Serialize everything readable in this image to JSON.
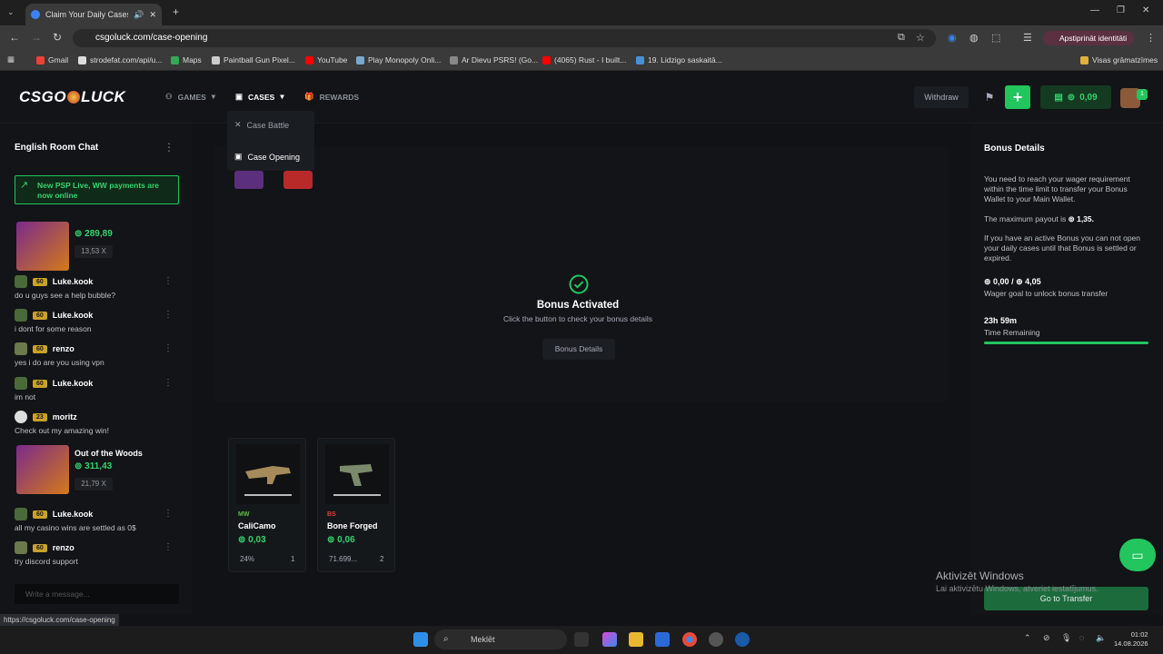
{
  "browser": {
    "tab_title": "Claim Your Daily Cases - CS",
    "url": "csgoluck.com/case-opening",
    "bookmarks": [
      "Gmail",
      "strodefat.com/api/u...",
      "Maps",
      "Paintball Gun Pixel...",
      "YouTube",
      "Play Monopoly Onli...",
      "Ar Dievu PSRS! (Go...",
      "(4065) Rust - I built...",
      "19. Lidzigo saskaitā..."
    ],
    "bookmarks_folder": "Visas grāmatzīmes",
    "profile": "Apstiprināt identitāti",
    "status_url": "https://csgoluck.com/case-opening"
  },
  "header": {
    "logo_a": "CSGO",
    "logo_b": "LUCK",
    "nav": {
      "games": "GAMES",
      "cases": "CASES",
      "rewards": "REWARDS"
    },
    "dropdown": {
      "battle": "Case Battle",
      "opening": "Case Opening"
    },
    "withdraw": "Withdraw",
    "balance": "0,09",
    "avatar_badge": "1"
  },
  "chat": {
    "title": "English Room Chat",
    "announcement": "New PSP Live, WW payments are now online",
    "win1": {
      "amount": "289,89",
      "mult": "13,53 X"
    },
    "messages": [
      {
        "level": "60",
        "name": "Luke.kook",
        "text": "do u guys see a help bubble?"
      },
      {
        "level": "60",
        "name": "Luke.kook",
        "text": "i dont for some reason"
      },
      {
        "level": "60",
        "name": "renzo",
        "text": "yes i do are you using vpn"
      },
      {
        "level": "60",
        "name": "Luke.kook",
        "text": "im not"
      },
      {
        "level": "23",
        "name": "moritz",
        "text": "Check out my amazing win!"
      },
      {
        "level": "60",
        "name": "Luke.kook",
        "text": "all my casino wins are settled as 0$"
      },
      {
        "level": "60",
        "name": "renzo",
        "text": "try discord support"
      }
    ],
    "win2": {
      "game": "Out of the Woods",
      "amount": "311,43",
      "mult": "21,79 X"
    },
    "input_placeholder": "Write a message..."
  },
  "main": {
    "bonus_title": "Bonus Activated",
    "bonus_sub": "Click the button to check your bonus details",
    "bonus_button": "Bonus Details",
    "items": [
      {
        "condition": "MW",
        "name": "CaliCamo",
        "price": "0,03",
        "pct": "24%",
        "count": "1",
        "cond_color": "#5cbf3a"
      },
      {
        "condition": "BS",
        "name": "Bone Forged",
        "price": "0,06",
        "pct": "71.699...",
        "count": "2",
        "cond_color": "#d9443a"
      }
    ]
  },
  "bonus_panel": {
    "title": "Bonus Details",
    "p1": "You need to reach your wager requirement within the time limit to transfer your Bonus Wallet to your Main Wallet.",
    "p2_prefix": "The maximum payout is",
    "p2_value": "1,35",
    "p3": "If you have an active Bonus you can not open your daily cases until that Bonus is settled or expired.",
    "wager_current": "0,00",
    "wager_goal": "4,05",
    "wager_label": "Wager goal to unlock bonus transfer",
    "time_value": "23h 59m",
    "time_label": "Time Remaining",
    "transfer_button": "Go to Transfer"
  },
  "os": {
    "watermark_title": "Aktivizēt Windows",
    "watermark_sub": "Lai aktivizētu Windows, atveriet iestatījumus.",
    "search": "Meklēt",
    "time": "01:02",
    "date": "14.08.2026"
  }
}
